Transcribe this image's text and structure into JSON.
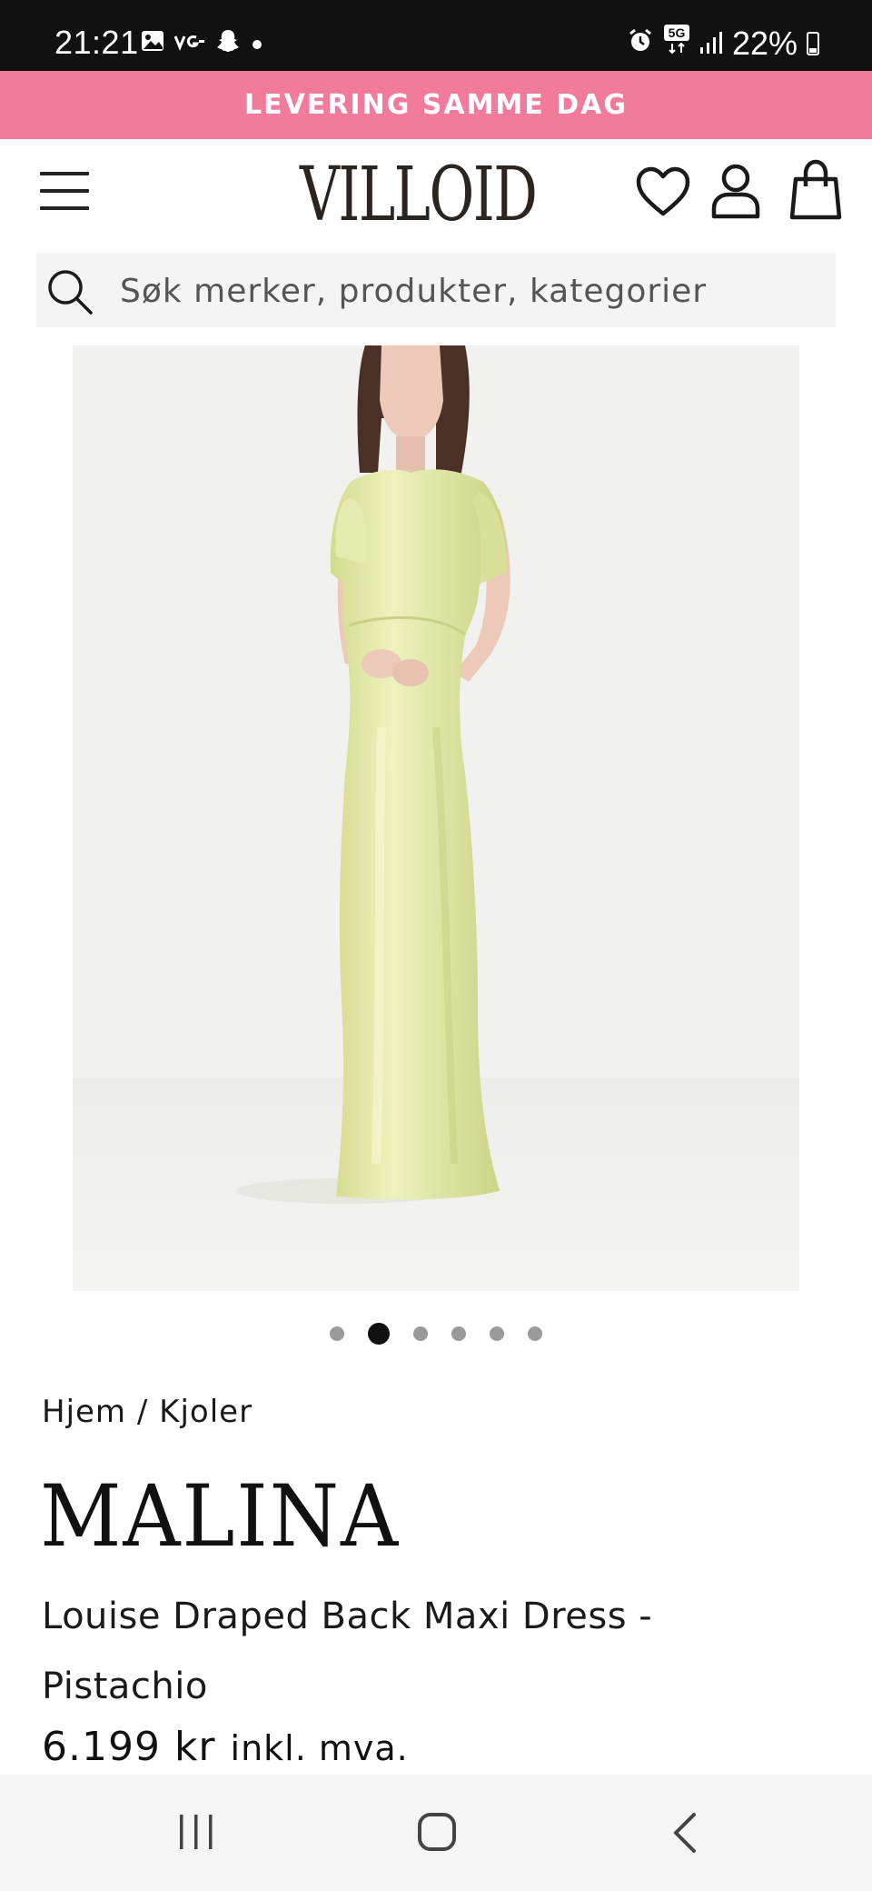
{
  "status_bar": {
    "time": "21:21",
    "left_icons": [
      "gallery-icon",
      "vg-icon",
      "snapchat-icon",
      "dot-icon"
    ],
    "network": "5G",
    "battery": "22%",
    "right_icons": [
      "alarm-icon",
      "5g-icon",
      "signal-icon",
      "battery-icon"
    ]
  },
  "promo": {
    "text": "LEVERING SAMME DAG",
    "color": "#f27a9b"
  },
  "header": {
    "logo": "VILLOID",
    "icons": [
      "menu-icon",
      "heart-icon",
      "user-icon",
      "bag-icon"
    ]
  },
  "search": {
    "placeholder": "Søk merker, produkter, kategorier"
  },
  "carousel": {
    "count": 6,
    "active_index": 1
  },
  "breadcrumb": {
    "home": "Hjem",
    "separator": "/",
    "category": "Kjoler"
  },
  "product": {
    "brand": "MALINA",
    "name": "Louise Draped Back Maxi Dress - Pistachio",
    "price": "6.199 kr",
    "vat_note": "inkl. mva.",
    "dress_color": "#dfe6a6"
  },
  "nav_bar": {
    "buttons": [
      "recent-apps-icon",
      "home-icon",
      "back-icon"
    ]
  }
}
